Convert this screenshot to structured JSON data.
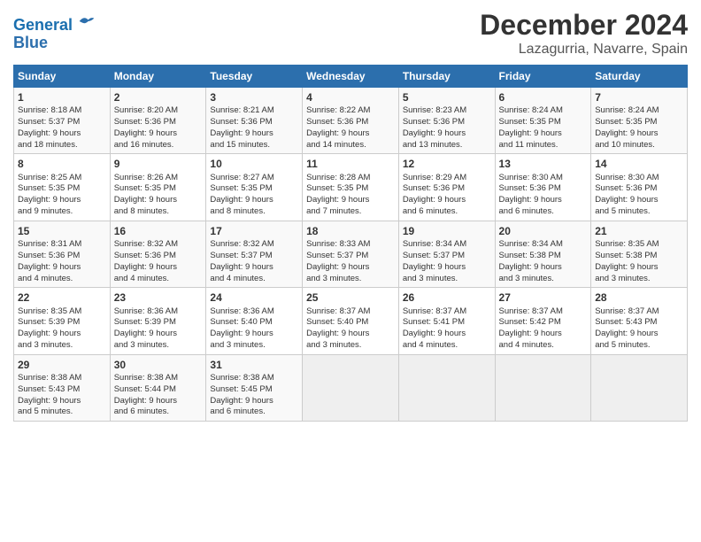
{
  "header": {
    "logo_line1": "General",
    "logo_line2": "Blue",
    "title": "December 2024",
    "subtitle": "Lazagurria, Navarre, Spain"
  },
  "days_of_week": [
    "Sunday",
    "Monday",
    "Tuesday",
    "Wednesday",
    "Thursday",
    "Friday",
    "Saturday"
  ],
  "weeks": [
    [
      {
        "day": "1",
        "lines": [
          "Sunrise: 8:18 AM",
          "Sunset: 5:37 PM",
          "Daylight: 9 hours",
          "and 18 minutes."
        ]
      },
      {
        "day": "2",
        "lines": [
          "Sunrise: 8:20 AM",
          "Sunset: 5:36 PM",
          "Daylight: 9 hours",
          "and 16 minutes."
        ]
      },
      {
        "day": "3",
        "lines": [
          "Sunrise: 8:21 AM",
          "Sunset: 5:36 PM",
          "Daylight: 9 hours",
          "and 15 minutes."
        ]
      },
      {
        "day": "4",
        "lines": [
          "Sunrise: 8:22 AM",
          "Sunset: 5:36 PM",
          "Daylight: 9 hours",
          "and 14 minutes."
        ]
      },
      {
        "day": "5",
        "lines": [
          "Sunrise: 8:23 AM",
          "Sunset: 5:36 PM",
          "Daylight: 9 hours",
          "and 13 minutes."
        ]
      },
      {
        "day": "6",
        "lines": [
          "Sunrise: 8:24 AM",
          "Sunset: 5:35 PM",
          "Daylight: 9 hours",
          "and 11 minutes."
        ]
      },
      {
        "day": "7",
        "lines": [
          "Sunrise: 8:24 AM",
          "Sunset: 5:35 PM",
          "Daylight: 9 hours",
          "and 10 minutes."
        ]
      }
    ],
    [
      {
        "day": "8",
        "lines": [
          "Sunrise: 8:25 AM",
          "Sunset: 5:35 PM",
          "Daylight: 9 hours",
          "and 9 minutes."
        ]
      },
      {
        "day": "9",
        "lines": [
          "Sunrise: 8:26 AM",
          "Sunset: 5:35 PM",
          "Daylight: 9 hours",
          "and 8 minutes."
        ]
      },
      {
        "day": "10",
        "lines": [
          "Sunrise: 8:27 AM",
          "Sunset: 5:35 PM",
          "Daylight: 9 hours",
          "and 8 minutes."
        ]
      },
      {
        "day": "11",
        "lines": [
          "Sunrise: 8:28 AM",
          "Sunset: 5:35 PM",
          "Daylight: 9 hours",
          "and 7 minutes."
        ]
      },
      {
        "day": "12",
        "lines": [
          "Sunrise: 8:29 AM",
          "Sunset: 5:36 PM",
          "Daylight: 9 hours",
          "and 6 minutes."
        ]
      },
      {
        "day": "13",
        "lines": [
          "Sunrise: 8:30 AM",
          "Sunset: 5:36 PM",
          "Daylight: 9 hours",
          "and 6 minutes."
        ]
      },
      {
        "day": "14",
        "lines": [
          "Sunrise: 8:30 AM",
          "Sunset: 5:36 PM",
          "Daylight: 9 hours",
          "and 5 minutes."
        ]
      }
    ],
    [
      {
        "day": "15",
        "lines": [
          "Sunrise: 8:31 AM",
          "Sunset: 5:36 PM",
          "Daylight: 9 hours",
          "and 4 minutes."
        ]
      },
      {
        "day": "16",
        "lines": [
          "Sunrise: 8:32 AM",
          "Sunset: 5:36 PM",
          "Daylight: 9 hours",
          "and 4 minutes."
        ]
      },
      {
        "day": "17",
        "lines": [
          "Sunrise: 8:32 AM",
          "Sunset: 5:37 PM",
          "Daylight: 9 hours",
          "and 4 minutes."
        ]
      },
      {
        "day": "18",
        "lines": [
          "Sunrise: 8:33 AM",
          "Sunset: 5:37 PM",
          "Daylight: 9 hours",
          "and 3 minutes."
        ]
      },
      {
        "day": "19",
        "lines": [
          "Sunrise: 8:34 AM",
          "Sunset: 5:37 PM",
          "Daylight: 9 hours",
          "and 3 minutes."
        ]
      },
      {
        "day": "20",
        "lines": [
          "Sunrise: 8:34 AM",
          "Sunset: 5:38 PM",
          "Daylight: 9 hours",
          "and 3 minutes."
        ]
      },
      {
        "day": "21",
        "lines": [
          "Sunrise: 8:35 AM",
          "Sunset: 5:38 PM",
          "Daylight: 9 hours",
          "and 3 minutes."
        ]
      }
    ],
    [
      {
        "day": "22",
        "lines": [
          "Sunrise: 8:35 AM",
          "Sunset: 5:39 PM",
          "Daylight: 9 hours",
          "and 3 minutes."
        ]
      },
      {
        "day": "23",
        "lines": [
          "Sunrise: 8:36 AM",
          "Sunset: 5:39 PM",
          "Daylight: 9 hours",
          "and 3 minutes."
        ]
      },
      {
        "day": "24",
        "lines": [
          "Sunrise: 8:36 AM",
          "Sunset: 5:40 PM",
          "Daylight: 9 hours",
          "and 3 minutes."
        ]
      },
      {
        "day": "25",
        "lines": [
          "Sunrise: 8:37 AM",
          "Sunset: 5:40 PM",
          "Daylight: 9 hours",
          "and 3 minutes."
        ]
      },
      {
        "day": "26",
        "lines": [
          "Sunrise: 8:37 AM",
          "Sunset: 5:41 PM",
          "Daylight: 9 hours",
          "and 4 minutes."
        ]
      },
      {
        "day": "27",
        "lines": [
          "Sunrise: 8:37 AM",
          "Sunset: 5:42 PM",
          "Daylight: 9 hours",
          "and 4 minutes."
        ]
      },
      {
        "day": "28",
        "lines": [
          "Sunrise: 8:37 AM",
          "Sunset: 5:43 PM",
          "Daylight: 9 hours",
          "and 5 minutes."
        ]
      }
    ],
    [
      {
        "day": "29",
        "lines": [
          "Sunrise: 8:38 AM",
          "Sunset: 5:43 PM",
          "Daylight: 9 hours",
          "and 5 minutes."
        ]
      },
      {
        "day": "30",
        "lines": [
          "Sunrise: 8:38 AM",
          "Sunset: 5:44 PM",
          "Daylight: 9 hours",
          "and 6 minutes."
        ]
      },
      {
        "day": "31",
        "lines": [
          "Sunrise: 8:38 AM",
          "Sunset: 5:45 PM",
          "Daylight: 9 hours",
          "and 6 minutes."
        ]
      },
      null,
      null,
      null,
      null
    ]
  ]
}
